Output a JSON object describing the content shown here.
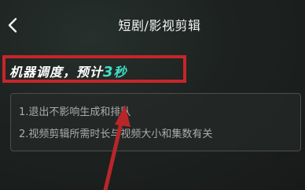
{
  "header": {
    "title": "短剧/影视剪辑",
    "back_icon": "chevron-left-icon"
  },
  "queue": {
    "prefix": "机器调度，预计",
    "eta_value": "3",
    "eta_unit": "秒",
    "accent_color": "#3fe0c4",
    "highlight_color": "#c7252a"
  },
  "info": {
    "line1": "1.退出不影响生成和排队",
    "line2": "2.视频剪辑所需时长与视频大小和集数有关"
  }
}
